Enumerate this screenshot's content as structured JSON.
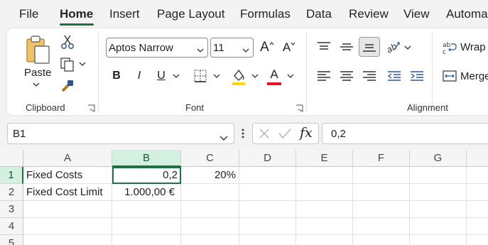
{
  "menu": {
    "tabs": [
      "File",
      "Home",
      "Insert",
      "Page Layout",
      "Formulas",
      "Data",
      "Review",
      "View",
      "Automa"
    ],
    "active": "Home"
  },
  "clipboard": {
    "paste_label": "Paste",
    "group_label": "Clipboard"
  },
  "font": {
    "family": "Aptos Narrow",
    "size": "11",
    "group_label": "Font",
    "bold": "B",
    "italic": "I",
    "underline": "U",
    "grow": "A",
    "shrink": "A",
    "font_color_glyph": "A",
    "fill_color": "#ffd700",
    "font_color": "#e81123"
  },
  "alignment": {
    "group_label": "Alignment",
    "wrap_label": "Wrap T",
    "merge_label": "Merge"
  },
  "formula_bar": {
    "name_box": "B1",
    "fx": "fx",
    "formula": "0,2"
  },
  "sheet": {
    "columns": [
      "A",
      "B",
      "C",
      "D",
      "E",
      "F",
      "G"
    ],
    "selected_column": "B",
    "rows": [
      "1",
      "2",
      "3",
      "4",
      "5"
    ],
    "selected_row": "1",
    "cells": {
      "A1": "Fixed Costs",
      "B1": "0,2",
      "C1": "20%",
      "A2": "Fixed Cost Limit",
      "B2": "1.000,00 €"
    }
  },
  "colors": {
    "accent": "#1e7145",
    "ribbon_bg": "#ffffff",
    "app_bg": "#f3f3f3"
  }
}
